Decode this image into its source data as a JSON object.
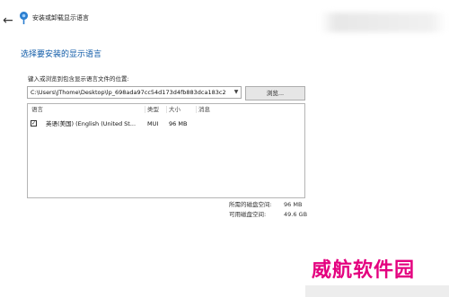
{
  "window": {
    "title": "安装或卸载显示语言"
  },
  "icons": {
    "back": "arrow-left-icon",
    "app": "language-globe-icon",
    "dropdown": "chevron-down-icon",
    "checkbox": "checkbox-checked-icon"
  },
  "main": {
    "heading": "选择要安装的显示语言",
    "path_label": "键入或浏览到包含显示语言文件的位置:",
    "path_value": "C:\\Users\\JThome\\Desktop\\lp_698ada97cc54d173d4fb883dca183c2",
    "browse_label": "浏览..."
  },
  "list": {
    "columns": [
      "语言",
      "类型",
      "大小",
      "消息"
    ],
    "rows": [
      {
        "checked": true,
        "language": "英语(美国) (English (United St...",
        "type": "MUI",
        "size": "96 MB",
        "message": ""
      }
    ]
  },
  "summary": {
    "required_label": "所需的磁盘空间:",
    "required_value": "96 MB",
    "available_label": "可用磁盘空间:",
    "available_value": "49.6 GB"
  },
  "watermark": "威航软件园",
  "colors": {
    "heading": "#0e5aa7",
    "watermark": "#e4007f"
  }
}
